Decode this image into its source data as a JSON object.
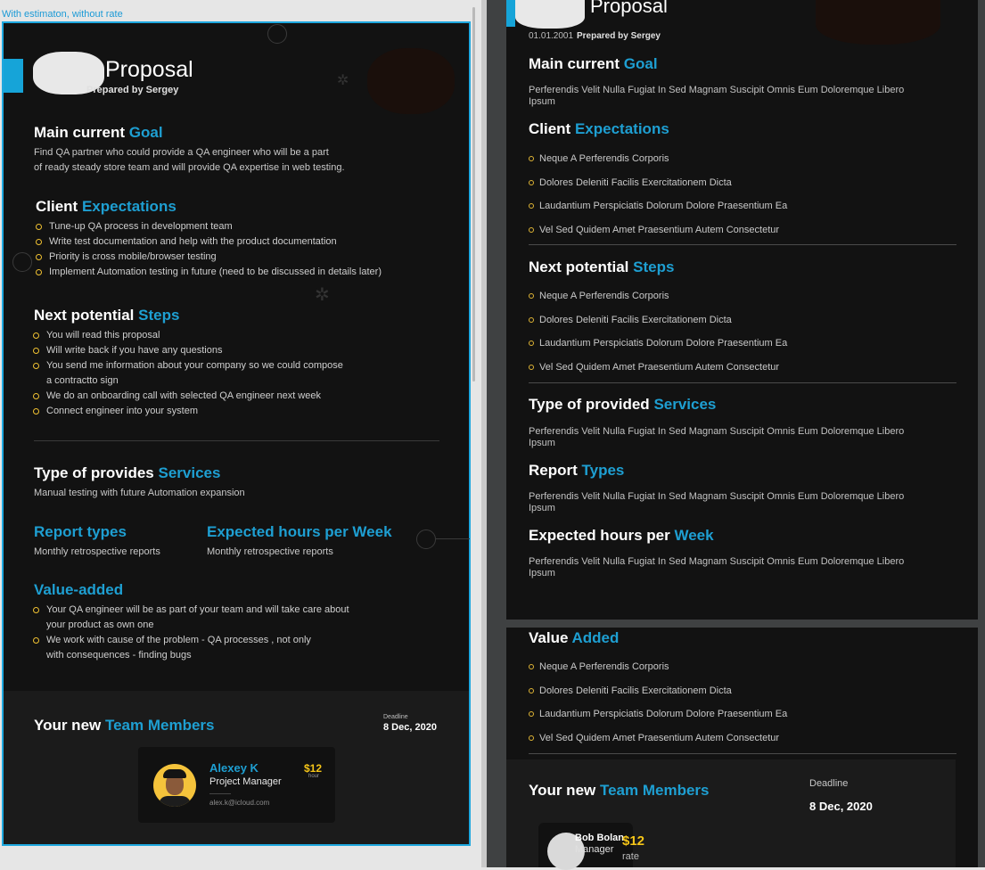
{
  "frame_label": "With estimaton, without rate",
  "left": {
    "title": "Proposal",
    "prepared_by": "Prepared by Sergey",
    "goal": {
      "heading_a": "Main current",
      "heading_b": "Goal",
      "text_1": "Find QA partner who could provide a QA engineer who will be a part",
      "text_2": "of ready steady store team and will provide QA expertise in web testing."
    },
    "expectations": {
      "heading_a": "Client",
      "heading_b": "Expectations",
      "items": [
        "Tune-up QA process in development team",
        "Write test documentation and help with the product documentation",
        "Priority is cross mobile/browser testing",
        "Implement Automation testing in future (need to be discussed in details later)"
      ]
    },
    "steps": {
      "heading_a": "Next potential",
      "heading_b": "Steps",
      "items": [
        "You will read this proposal",
        "Will write back if you have any questions",
        "You send me information about your company so we could compose",
        "We do an onboarding call with selected QA engineer next week",
        "Connect engineer into your system"
      ],
      "item_3_cont": "a contractto sign"
    },
    "services": {
      "heading_a": "Type of provides",
      "heading_b": "Services",
      "text": "Manual testing with future Automation expansion"
    },
    "report": {
      "heading": "Report types",
      "text": "Monthly retrospective reports"
    },
    "hours": {
      "heading": "Expected hours per Week",
      "text": "Monthly retrospective reports"
    },
    "value": {
      "heading": "Value-added",
      "item_1": "Your QA engineer will be as part of your team and will take care about",
      "item_1_cont": "your product as own one",
      "item_2": "We work with cause of the problem - QA processes , not only",
      "item_2_cont": "with consequences - finding bugs"
    },
    "team": {
      "heading_a": "Your new",
      "heading_b": "Team Members",
      "deadline_label": "Deadline",
      "deadline": "8 Dec, 2020",
      "member": {
        "name": "Alexey K",
        "role": "Project Manager",
        "email": "alex.k@icloud.com",
        "price": "$12",
        "unit": "hour"
      }
    }
  },
  "right": {
    "title": "Proposal",
    "date": "01.01.2001",
    "prepared_by": "Prepared by Sergey",
    "goal": {
      "heading_a": "Main current",
      "heading_b": "Goal",
      "text_1": "Perferendis Velit Nulla Fugiat In Sed Magnam Suscipit Omnis Eum Doloremque Libero",
      "text_2": "Ipsum"
    },
    "expectations": {
      "heading_a": "Client",
      "heading_b": "Expectations",
      "items": [
        "Neque A Perferendis Corporis",
        "Dolores Deleniti Facilis Exercitationem Dicta",
        "Laudantium Perspiciatis Dolorum Dolore Praesentium Ea",
        "Vel Sed Quidem Amet Praesentium Autem Consectetur"
      ]
    },
    "steps": {
      "heading_a": "Next potential",
      "heading_b": "Steps",
      "items": [
        "Neque A Perferendis Corporis",
        "Dolores Deleniti Facilis Exercitationem Dicta",
        "Laudantium Perspiciatis Dolorum Dolore Praesentium Ea",
        "Vel Sed Quidem Amet Praesentium Autem Consectetur"
      ]
    },
    "services": {
      "heading_a": "Type of provided",
      "heading_b": "Services",
      "text_1": "Perferendis Velit Nulla Fugiat In Sed Magnam Suscipit Omnis Eum Doloremque Libero",
      "text_2": "Ipsum"
    },
    "report": {
      "heading_a": "Report",
      "heading_b": "Types",
      "text_1": "Perferendis Velit Nulla Fugiat In Sed Magnam Suscipit Omnis Eum Doloremque Libero",
      "text_2": "Ipsum"
    },
    "hours": {
      "heading_a": "Expected hours per",
      "heading_b": "Week",
      "text_1": "Perferendis Velit Nulla Fugiat In Sed Magnam Suscipit Omnis Eum Doloremque Libero",
      "text_2": "Ipsum"
    },
    "value": {
      "heading_a": "Value",
      "heading_b": "Added",
      "items": [
        "Neque A Perferendis Corporis",
        "Dolores Deleniti Facilis Exercitationem Dicta",
        "Laudantium Perspiciatis Dolorum Dolore Praesentium Ea",
        "Vel Sed Quidem Amet Praesentium Autem Consectetur"
      ]
    },
    "team": {
      "heading_a": "Your new",
      "heading_b": "Team Members",
      "deadline_label": "Deadline",
      "deadline": "8 Dec, 2020",
      "member": {
        "name": "Bob Bolan",
        "role": "Manager",
        "price": "$12",
        "unit": "rate"
      }
    }
  },
  "colors": {
    "accent": "#1e9fd2",
    "bullet": "#f1c232",
    "price": "#f5c518",
    "background": "#121212"
  }
}
